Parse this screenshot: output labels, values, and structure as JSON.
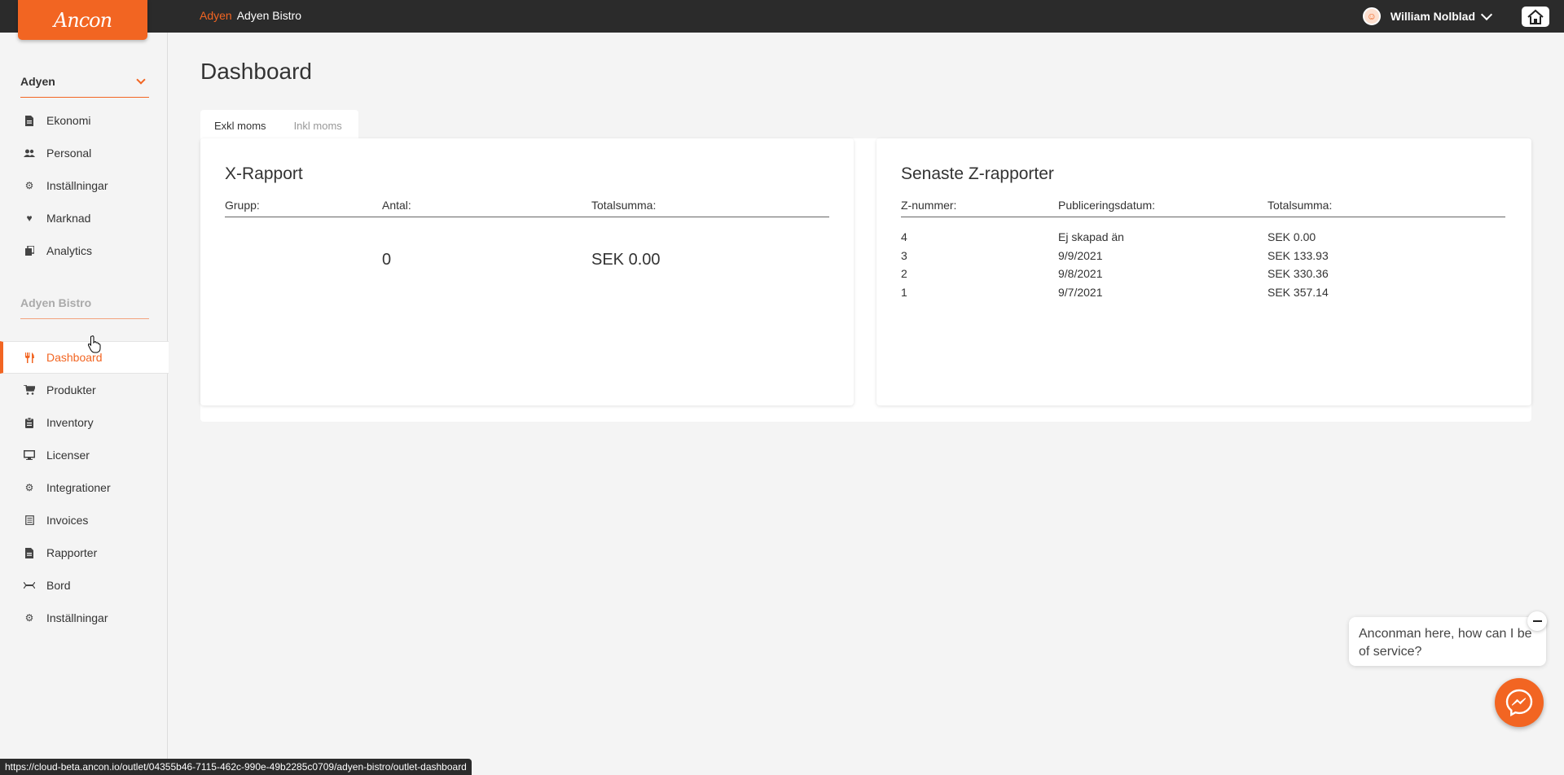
{
  "app": {
    "logo_text": "Ancon",
    "brand_color": "#f26522"
  },
  "header": {
    "breadcrumb_org": "Adyen",
    "breadcrumb_outlet": "Adyen Bistro",
    "user_name": "William Nolblad"
  },
  "sidebar": {
    "org_selector": "Adyen",
    "org_items": [
      {
        "label": "Ekonomi",
        "icon": "receipt-icon"
      },
      {
        "label": "Personal",
        "icon": "users-icon"
      },
      {
        "label": "Inställningar",
        "icon": "gears-icon"
      },
      {
        "label": "Marknad",
        "icon": "heart-icon"
      },
      {
        "label": "Analytics",
        "icon": "copy-icon"
      }
    ],
    "outlet_section": "Adyen Bistro",
    "outlet_items": [
      {
        "label": "Dashboard",
        "icon": "utensils-icon",
        "active": true
      },
      {
        "label": "Produkter",
        "icon": "cart-icon"
      },
      {
        "label": "Inventory",
        "icon": "clipboard-icon"
      },
      {
        "label": "Licenser",
        "icon": "monitor-icon"
      },
      {
        "label": "Integrationer",
        "icon": "gears-icon"
      },
      {
        "label": "Invoices",
        "icon": "invoice-icon"
      },
      {
        "label": "Rapporter",
        "icon": "document-icon"
      },
      {
        "label": "Bord",
        "icon": "table-icon"
      },
      {
        "label": "Inställningar",
        "icon": "gear-icon"
      }
    ]
  },
  "main": {
    "title": "Dashboard",
    "tabs": [
      {
        "label": "Exkl moms",
        "active": true
      },
      {
        "label": "Inkl moms",
        "active": false
      }
    ],
    "x_report": {
      "title": "X-Rapport",
      "headers": [
        "Grupp:",
        "Antal:",
        "Totalsumma:"
      ],
      "count": "0",
      "total": "SEK 0.00"
    },
    "z_reports": {
      "title": "Senaste Z-rapporter",
      "headers": [
        "Z-nummer:",
        "Publiceringsdatum:",
        "Totalsumma:"
      ],
      "rows": [
        {
          "number": "4",
          "date": "Ej skapad än",
          "total": "SEK 0.00"
        },
        {
          "number": "3",
          "date": "9/9/2021",
          "total": "SEK 133.93"
        },
        {
          "number": "2",
          "date": "9/8/2021",
          "total": "SEK 330.36"
        },
        {
          "number": "1",
          "date": "9/7/2021",
          "total": "SEK 357.14"
        }
      ]
    }
  },
  "chat": {
    "message": "Anconman here, how can I be of service?"
  },
  "status_bar": {
    "url": "https://cloud-beta.ancon.io/outlet/04355b46-7115-462c-990e-49b2285c0709/adyen-bistro/outlet-dashboard"
  }
}
